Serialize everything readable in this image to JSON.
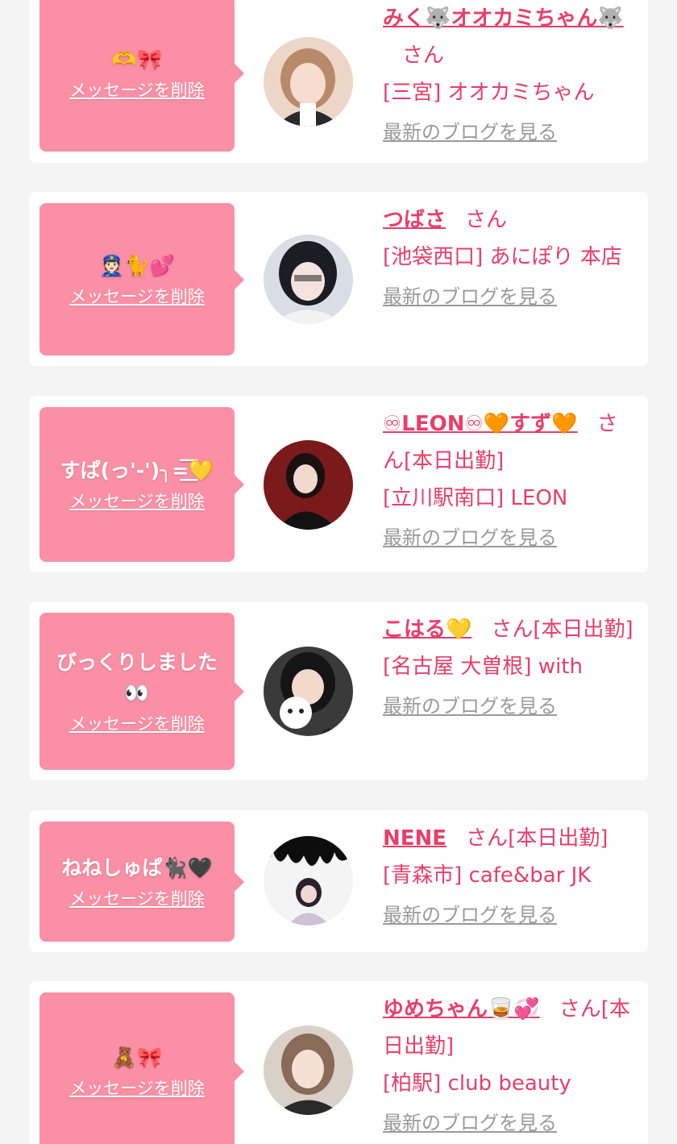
{
  "colors": {
    "background": "#f4f4f4",
    "card": "#ffffff",
    "bubble": "#fb8fa5",
    "accent": "#e83e6a",
    "link_gray": "#9a9a9a"
  },
  "labels": {
    "delete": "メッセージを削除",
    "blog": "最新のブログを見る",
    "san": "さん"
  },
  "messages": [
    {
      "message": "🫶🎀",
      "name": "みく🐺オオカミちゃん🐺",
      "status": "",
      "shop": "[三宮] オオカミちゃん",
      "avatar_icon": "profile-photo-icon"
    },
    {
      "message": "👮🏻🐈💕",
      "name": "つばさ",
      "status": "",
      "shop": "[池袋西口] あにぽり 本店",
      "avatar_icon": "profile-photo-icon"
    },
    {
      "message": "すぱ(っ'-')╮=͟͟͞͞💛",
      "name": "♾LEON♾🧡すず🧡",
      "status": "[本日出勤]",
      "shop": "[立川駅南口] LEON",
      "avatar_icon": "profile-photo-icon"
    },
    {
      "message": "びっくりしました👀",
      "name": "こはる💛",
      "status": "[本日出勤]",
      "shop": "[名古屋 大曽根] with",
      "avatar_icon": "profile-photo-icon"
    },
    {
      "message": "ねねしゅぱ🐈‍⬛🖤",
      "name": "NENE",
      "status": "[本日出勤]",
      "shop": "[青森市] cafe&bar JK",
      "avatar_icon": "profile-photo-icon"
    },
    {
      "message": "🧸🎀",
      "name": "ゆめちゃん🥃💞",
      "status": "[本日出勤]",
      "shop": "[柏駅] club beauty",
      "avatar_icon": "profile-photo-icon"
    }
  ]
}
